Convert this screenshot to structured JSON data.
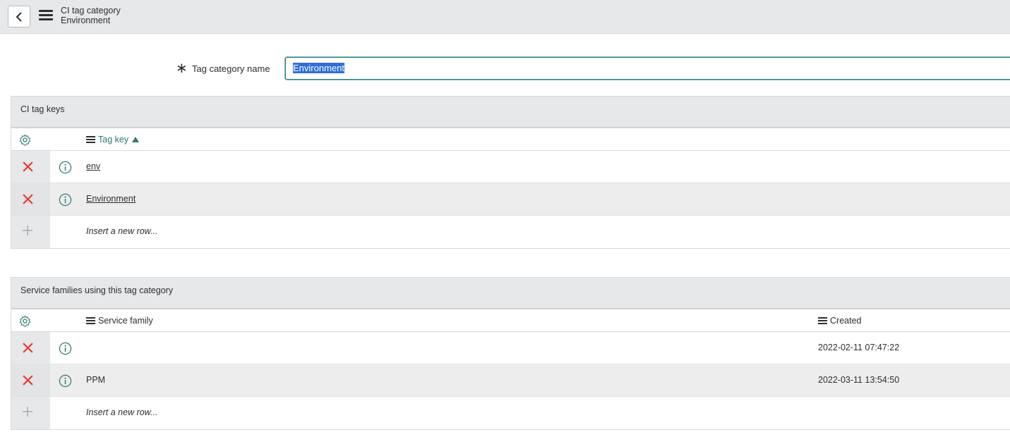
{
  "header": {
    "back_icon": "chevron-left-icon",
    "menu_icon": "hamburger-icon",
    "title": "CI tag category",
    "subtitle": "Environment"
  },
  "form": {
    "required_mark": "∗",
    "field_label": "Tag category name",
    "field_value": "Environment"
  },
  "tag_keys": {
    "title": "CI tag keys",
    "column": "Tag key",
    "sort": "ascending",
    "rows": [
      {
        "tag_key": "env"
      },
      {
        "tag_key": "Environment"
      }
    ],
    "insert_label": "Insert a new row..."
  },
  "service_families": {
    "title": "Service families using this tag category",
    "columns": {
      "service_family": "Service family",
      "created": "Created"
    },
    "rows": [
      {
        "service_family": "",
        "created": "2022-02-11 07:47:22"
      },
      {
        "service_family": "PPM",
        "created": "2022-03-11 13:54:50"
      }
    ],
    "insert_label": "Insert a new row..."
  },
  "colors": {
    "accent": "#2f7a6f",
    "delete": "#e8392b",
    "header_bg": "#e6e8ea",
    "selection": "#2f6fd6"
  }
}
